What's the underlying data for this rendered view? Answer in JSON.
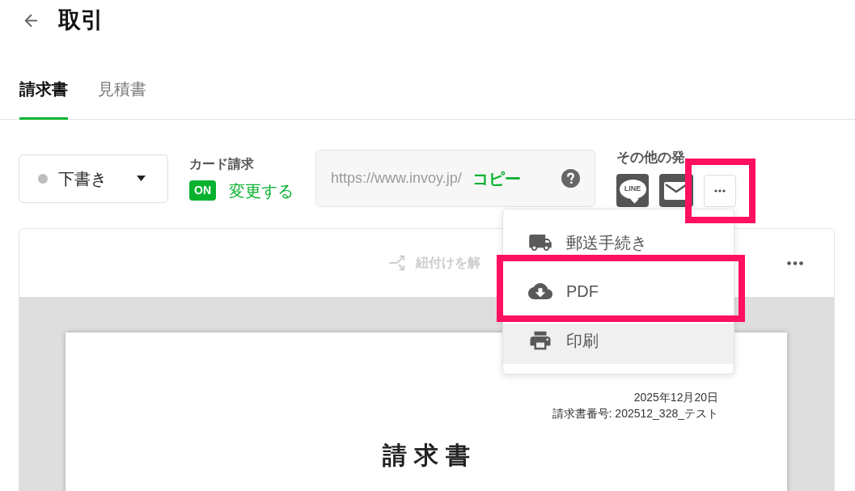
{
  "header": {
    "title": "取引"
  },
  "tabs": [
    {
      "label": "請求書",
      "selected": true
    },
    {
      "label": "見積書",
      "selected": false
    }
  ],
  "status": {
    "label": "下書き",
    "color": "#bdbdbd"
  },
  "card_billing": {
    "label": "カード請求",
    "on": true,
    "badge": "ON",
    "action": "変更する"
  },
  "share_url": {
    "value": "https://www.invoy.jp/",
    "copy": "コピー"
  },
  "other_issue": {
    "label": "その他の発",
    "buttons": [
      {
        "kind": "line",
        "label": "LINE"
      },
      {
        "kind": "mail"
      }
    ],
    "more_button": {
      "highlighted": true
    }
  },
  "toolbar": {
    "unlink": {
      "label": "紐付けを解",
      "disabled": true
    }
  },
  "menu": {
    "items": [
      {
        "kind": "post",
        "label": "郵送手続き",
        "highlighted": false,
        "hovered": false
      },
      {
        "kind": "pdf",
        "label": "PDF",
        "highlighted": true,
        "hovered": false
      },
      {
        "kind": "print",
        "label": "印刷",
        "highlighted": false,
        "hovered": true
      }
    ]
  },
  "document": {
    "date": "2025年12月20日",
    "number": "請求書番号: 202512_328_テスト",
    "title": "請求書"
  }
}
